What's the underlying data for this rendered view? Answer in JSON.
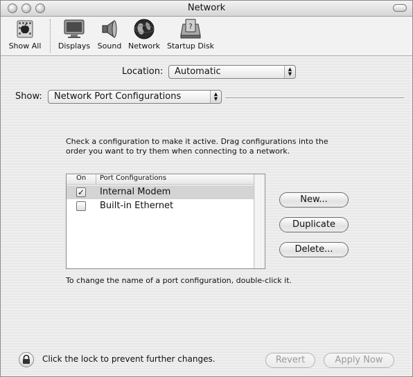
{
  "window": {
    "title": "Network"
  },
  "toolbar": {
    "items": [
      {
        "label": "Show All",
        "icon": "apple-icon"
      },
      {
        "label": "Displays",
        "icon": "monitor-icon"
      },
      {
        "label": "Sound",
        "icon": "speaker-icon"
      },
      {
        "label": "Network",
        "icon": "globe-icon"
      },
      {
        "label": "Startup Disk",
        "icon": "disk-icon"
      }
    ]
  },
  "location": {
    "label": "Location:",
    "value": "Automatic"
  },
  "show": {
    "label": "Show:",
    "value": "Network Port Configurations"
  },
  "instructions": "Check a configuration to make it active. Drag configurations into the order you want to try them when connecting to a network.",
  "port_list": {
    "columns": [
      "On",
      "Port Configurations"
    ],
    "rows": [
      {
        "on": true,
        "name": "Internal Modem"
      },
      {
        "on": false,
        "name": "Built-in Ethernet"
      }
    ]
  },
  "buttons": {
    "new": "New...",
    "duplicate": "Duplicate",
    "delete": "Delete..."
  },
  "note": "To change the name of a port configuration, double-click it.",
  "footer": {
    "lock_text": "Click the lock to prevent further changes.",
    "revert": "Revert",
    "apply": "Apply Now"
  }
}
